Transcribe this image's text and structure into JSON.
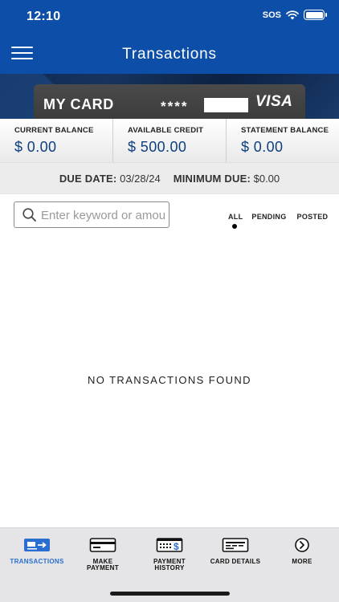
{
  "status_bar": {
    "time": "12:10",
    "sos": "SOS"
  },
  "header": {
    "title": "Transactions"
  },
  "card": {
    "name": "MY CARD",
    "masked_number": "****",
    "brand": "VISA"
  },
  "balances": [
    {
      "label": "CURRENT BALANCE",
      "value": "$ 0.00"
    },
    {
      "label": "AVAILABLE CREDIT",
      "value": "$ 500.00"
    },
    {
      "label": "STATEMENT BALANCE",
      "value": "$ 0.00"
    }
  ],
  "due": {
    "due_label": "DUE DATE:",
    "due_value": "03/28/24",
    "min_label": "MINIMUM DUE:",
    "min_value": "$0.00"
  },
  "search": {
    "placeholder": "Enter keyword or amount",
    "value": ""
  },
  "filters": {
    "all": "ALL",
    "pending": "PENDING",
    "posted": "POSTED",
    "selected": "ALL"
  },
  "empty_message": "NO TRANSACTIONS FOUND",
  "bottom_nav": {
    "active": "TRANSACTIONS",
    "items": [
      {
        "label": "TRANSACTIONS",
        "icon": "card-transfer-icon"
      },
      {
        "label": "MAKE PAYMENT",
        "icon": "card-icon"
      },
      {
        "label": "PAYMENT HISTORY",
        "icon": "calendar-dollar-icon"
      },
      {
        "label": "CARD DETAILS",
        "icon": "card-details-icon"
      },
      {
        "label": "MORE",
        "icon": "chevron-right-circle-icon"
      }
    ]
  },
  "colors": {
    "header_blue": "#0d4fa8",
    "balance_blue": "#0d3f7f",
    "active_nav": "#2a6fd0"
  }
}
